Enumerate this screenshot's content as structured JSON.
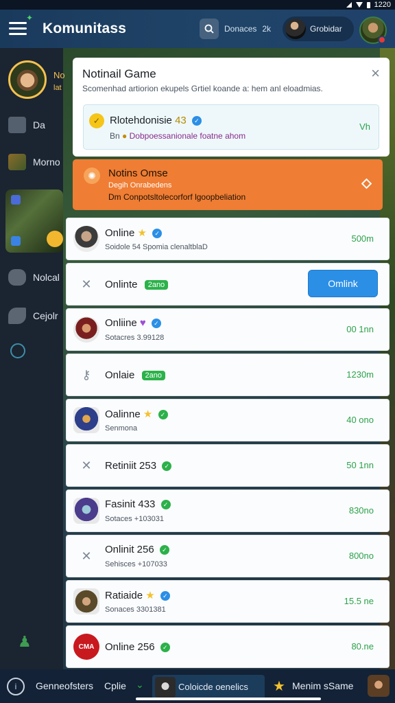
{
  "status": {
    "time": "1220"
  },
  "header": {
    "title": "Komunitass",
    "search_text": "Donaces",
    "search_extra": "2k",
    "user_chip_label": "Grobidar"
  },
  "sidebar": {
    "items": [
      {
        "label": "Da",
        "icon": "shop-icon"
      },
      {
        "label": "Morno",
        "icon": "game-icon"
      },
      {
        "label": "Nolcal",
        "icon": "controller-icon"
      },
      {
        "label": "Cejolr",
        "icon": "wrench-icon"
      }
    ],
    "avatar_badge_1": "No",
    "avatar_badge_2": "lat"
  },
  "notification": {
    "title": "Notinail Game",
    "subtitle": "Scomenhad artiorion ekupels Grtiel koande a: hem anl eloadmias.",
    "close": "×",
    "card": {
      "name": "Rlotehdonisie",
      "name_badge": "43",
      "desc_prefix": "Bn",
      "desc": "Dobpoessanionale foatne ahom",
      "right": "Vh"
    },
    "alert": {
      "title": "Notins Omse",
      "sub1": "Degih Onrabedens",
      "sub2_prefix": "Dm",
      "sub2": "Conpotsltolecorforf lgoopbeliation"
    }
  },
  "list": [
    {
      "name": "Online",
      "sub": "Soidole 54 Spomia clenaltblaD",
      "right": "500m",
      "avatar": "soldier",
      "badges": [
        "star",
        "blue"
      ]
    },
    {
      "name": "Onlinte",
      "chip": "2ano",
      "button": "Omlink",
      "avatar": "generic"
    },
    {
      "name": "Onliine",
      "sub": "Sotacres 3.99128",
      "right": "00 1nn",
      "avatar": "red",
      "badges": [
        "purple",
        "blue"
      ]
    },
    {
      "name": "Onlaie",
      "chip": "2ano",
      "right": "1230m",
      "avatar": "generic-key"
    },
    {
      "name": "Oalinne",
      "sub": "Senmona",
      "right": "40 ono",
      "avatar": "blue",
      "badges": [
        "star",
        "green"
      ]
    },
    {
      "name": "Retiniit 253",
      "right": "50 1nn",
      "avatar": "generic",
      "badges": [
        "green"
      ]
    },
    {
      "name": "Fasinit 433",
      "sub": "Sotaces +103031",
      "right": "830no",
      "avatar": "purple",
      "badges": [
        "green"
      ]
    },
    {
      "name": "Onlinit 256",
      "sub": "Sehisces +107033",
      "right": "800no",
      "avatar": "generic",
      "badges": [
        "green"
      ]
    },
    {
      "name": "Ratiaide",
      "sub": "Sonaces 3301381",
      "right": "15.5 ne",
      "avatar": "hat",
      "badges": [
        "star",
        "blue"
      ]
    },
    {
      "name": "Online 256",
      "right": "80.ne",
      "avatar": "logo",
      "logo_text": "CMA",
      "badges": [
        "green"
      ]
    }
  ],
  "bottom": {
    "left_label": "Genneofsters",
    "option": "Cplie",
    "pill_label": "Coloicde oenelics",
    "star_label": "Menim sSame"
  }
}
